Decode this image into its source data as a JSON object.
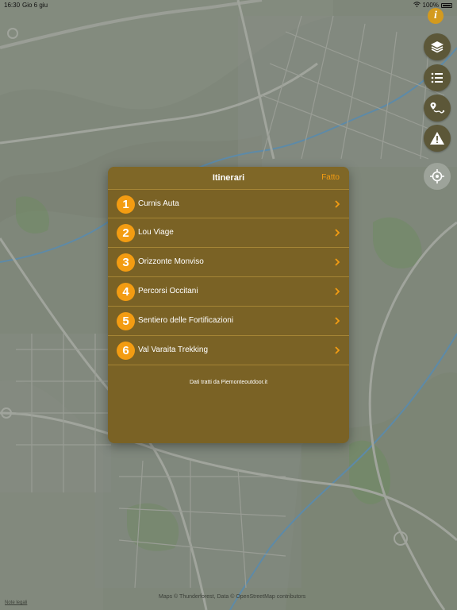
{
  "status_bar": {
    "time": "16:30",
    "date": "Gio 6 giu",
    "battery": "100%",
    "wifi_icon": "wifi-icon",
    "battery_icon": "battery-icon"
  },
  "map": {
    "attribution": "Maps © Thunderforest, Data © OpenStreetMap contributors",
    "legal_label": "Note legali"
  },
  "controls": {
    "info_label": "i",
    "info_color": "#d39a1e",
    "fab_color": "#5c5738",
    "icons": [
      "layers-icon",
      "list-icon",
      "route-icon",
      "warning-icon",
      "locate-icon"
    ]
  },
  "modal": {
    "title": "Itinerari",
    "done_label": "Fatto",
    "accent_color": "#f39c12",
    "items": [
      {
        "number": "1",
        "label": "Curnis Auta"
      },
      {
        "number": "2",
        "label": "Lou Viage"
      },
      {
        "number": "3",
        "label": "Orizzonte Monviso"
      },
      {
        "number": "4",
        "label": "Percorsi Occitani"
      },
      {
        "number": "5",
        "label": "Sentiero delle Fortificazioni"
      },
      {
        "number": "6",
        "label": "Val Varaita Trekking"
      }
    ],
    "footer": "Dati tratti da Piemonteoutdoor.it"
  }
}
